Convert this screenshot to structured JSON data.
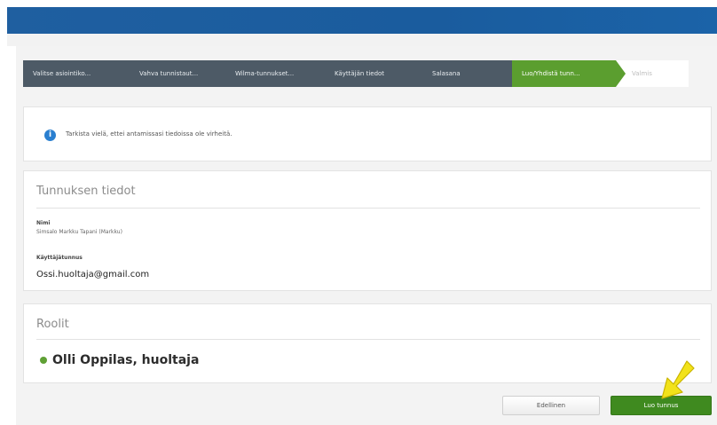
{
  "steps": [
    "Valitse asiointiko...",
    "Vahva tunnistaut...",
    "Wilma-tunnukset...",
    "Käyttäjän tiedot",
    "Salasana",
    "Luo/Yhdistä tunn...",
    "Valmis"
  ],
  "info": {
    "icon": "info-icon",
    "text": "Tarkista vielä, ettei antamissasi tiedoissa ole virheitä."
  },
  "details": {
    "title": "Tunnuksen tiedot",
    "name_label": "Nimi",
    "name_value": "Simsalo Markku Tapani (Markku)",
    "username_label": "Käyttäjätunnus",
    "username_value": "Ossi.huoltaja@gmail.com"
  },
  "roles": {
    "title": "Roolit",
    "items": [
      "Olli Oppilas, huoltaja"
    ],
    "dot_color": "#5fa035"
  },
  "buttons": {
    "previous": "Edellinen",
    "create": "Luo tunnus"
  },
  "colors": {
    "header": "#1f5fa0",
    "steps_bg": "#4d5a66",
    "active_step": "#5b9e2f",
    "primary_button": "#3f8a1f",
    "arrow": "#f2e21a"
  },
  "pointer": {
    "icon": "arrow-pointer-icon"
  }
}
